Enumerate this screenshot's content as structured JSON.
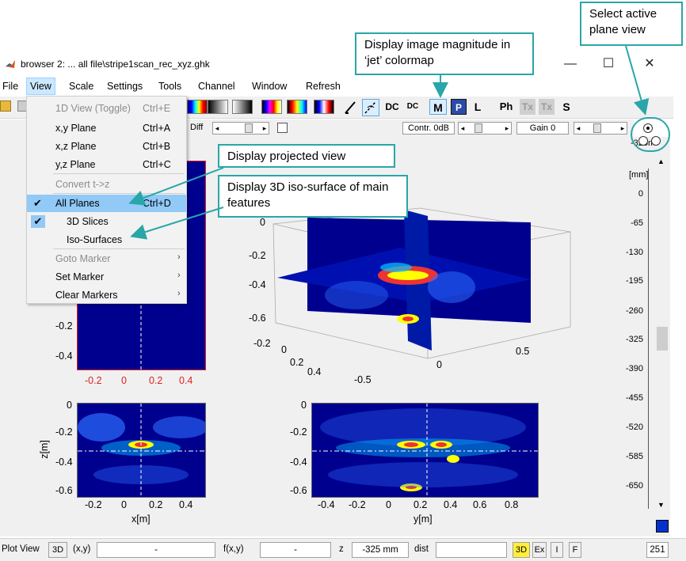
{
  "window": {
    "title": "browser 2: ... all file\\stripe1scan_rec_xyz.ghk",
    "minimize": "—",
    "maximize": "☐",
    "close": "✕"
  },
  "menubar": [
    "File",
    "View",
    "Scale",
    "Settings",
    "Tools",
    "Channel",
    "Window",
    "Refresh"
  ],
  "toolbar": {
    "icons": [
      "colormap-gray-icon",
      "colormap-jet-icon"
    ],
    "buttons": [
      "DC",
      "DC",
      "M",
      "P",
      "L",
      "Ph",
      "Tx",
      "Tx",
      "S"
    ]
  },
  "controls": {
    "diff_label": "Diff",
    "contrast_label": "Contr. 0dB",
    "gain_label": "Gain 0"
  },
  "view_menu": {
    "items": [
      {
        "label": "1D View (Toggle)",
        "shortcut": "Ctrl+E",
        "disabled": true
      },
      {
        "label": "x,y Plane",
        "shortcut": "Ctrl+A"
      },
      {
        "label": "x,z Plane",
        "shortcut": "Ctrl+B"
      },
      {
        "label": "y,z Plane",
        "shortcut": "Ctrl+C"
      },
      {
        "label": "Convert t->z",
        "disabled": true
      },
      {
        "label": "All Planes",
        "shortcut": "Ctrl+D",
        "checked": true,
        "highlight": true
      },
      {
        "label": "3D Slices",
        "checked": true
      },
      {
        "label": "Iso-Surfaces"
      },
      {
        "label": "Goto Marker",
        "submenu": true,
        "disabled": true
      },
      {
        "label": "Set Marker",
        "submenu": true
      },
      {
        "label": "Clear Markers",
        "submenu": true
      }
    ]
  },
  "callouts": {
    "plane_view": "Select active plane view",
    "magnitude": "Display image magnitude in ‘jet’ colormap",
    "projected": "Display projected view",
    "iso": "Display 3D iso-surface of main features"
  },
  "plots": {
    "xy_ticks_y": [
      "-0.2",
      "-0.4"
    ],
    "xy_ticks_x": [
      "-0.2",
      "0",
      "0.2",
      "0.4"
    ],
    "xz_ticks_y": [
      "0",
      "-0.2",
      "-0.4",
      "-0.6"
    ],
    "xz_ticks_x": [
      "-0.2",
      "0",
      "0.2",
      "0.4"
    ],
    "xz_xlabel": "x[m]",
    "xz_ylabel": "z[m]",
    "yz_ticks_y": [
      "0",
      "-0.2",
      "-0.4",
      "-0.6"
    ],
    "yz_ticks_x": [
      "-0.4",
      "-0.2",
      "0",
      "0.2",
      "0.4",
      "0.6",
      "0.8"
    ],
    "yz_xlabel": "y[m]",
    "v3d_z_ticks": [
      "0",
      "-0.2",
      "-0.4",
      "-0.6"
    ],
    "v3d_x_ticks": [
      "-0.2",
      "0",
      "0.2",
      "0.4"
    ],
    "v3d_y_ticks": [
      "0.5",
      "0",
      "-0.5"
    ]
  },
  "depth_scale": {
    "unit": "[mm]",
    "top_value": "-325m",
    "ticks": [
      "0",
      "-65",
      "-130",
      "-195",
      "-260",
      "-325",
      "-390",
      "-455",
      "-520",
      "-585",
      "-650"
    ]
  },
  "statusbar": {
    "plot_view": "Plot View",
    "btn_3d": "3D",
    "xy_label": "(x,y)",
    "xy_value": "-",
    "fxy_label": "f(x,y)",
    "fxy_value": "-",
    "z_label": "z",
    "z_value": "-325 mm",
    "dist_label": "dist",
    "dist_value": "",
    "btn_3d2": "3D",
    "btn_ex": "Ex",
    "btn_i": "I",
    "btn_f": "F",
    "count": "251"
  },
  "colors": {
    "jet_bg": "#00008f",
    "teal": "#2aa6a8",
    "highlight": "#91c9f7"
  }
}
